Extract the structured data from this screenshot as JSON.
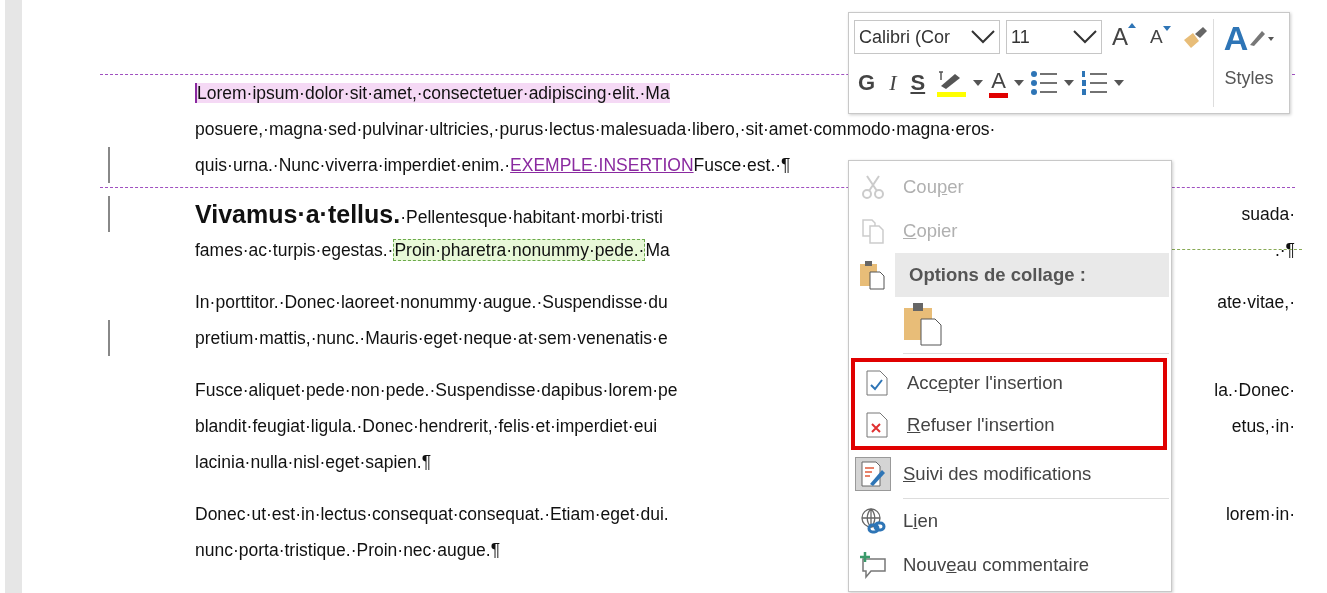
{
  "document": {
    "paragraphs": [
      {
        "kind": "tracked",
        "lines": [
          {
            "changed": false,
            "segments": [
              {
                "kind": "comment-highlight",
                "text": "Lorem·ipsum·dolor·sit·amet,·consectetuer·adipiscing·elit.·Ma"
              }
            ]
          },
          {
            "changed": false,
            "segments": [
              {
                "kind": "plain",
                "text": "posuere,·magna·sed·pulvinar·ultricies,·purus·lectus·malesuada·libero,·sit·amet·commodo·magna·eros·"
              }
            ]
          },
          {
            "changed": true,
            "segments": [
              {
                "kind": "plain",
                "text": "quis·urna.·Nunc·viverra·imperdiet·enim.·"
              },
              {
                "kind": "insertion",
                "text": "EXEMPLE·INSERTION"
              },
              {
                "kind": "plain",
                "text": "Fusce·est.·¶"
              }
            ]
          }
        ]
      },
      {
        "kind": "normal",
        "lines": [
          {
            "changed": true,
            "segments": [
              {
                "kind": "heading",
                "text": "Vivamus·a·tellus."
              },
              {
                "kind": "plain",
                "text": "·Pellentesque·habitant·morbi·tristi"
              }
            ],
            "right": "suada·"
          },
          {
            "changed": false,
            "segments": [
              {
                "kind": "plain",
                "text": "fames·ac·turpis·egestas.·"
              },
              {
                "kind": "format-highlight",
                "text": "Proin·pharetra·nonummy·pede.·"
              },
              {
                "kind": "plain",
                "text": "Ma"
              }
            ],
            "right": ".·¶"
          }
        ]
      },
      {
        "kind": "normal",
        "lines": [
          {
            "changed": false,
            "segments": [
              {
                "kind": "plain",
                "text": "In·porttitor.·Donec·laoreet·nonummy·augue.·Suspendisse·du"
              }
            ],
            "right": "ate·vitae,·"
          },
          {
            "changed": true,
            "segments": [
              {
                "kind": "plain",
                "text": "pretium·mattis,·nunc.·Mauris·eget·neque·at·sem·venenatis·e"
              }
            ]
          }
        ]
      },
      {
        "kind": "normal",
        "lines": [
          {
            "changed": false,
            "segments": [
              {
                "kind": "plain",
                "text": "Fusce·aliquet·pede·non·pede.·Suspendisse·dapibus·lorem·pe"
              }
            ],
            "right": "la.·Donec·"
          },
          {
            "changed": false,
            "segments": [
              {
                "kind": "plain",
                "text": "blandit·feugiat·ligula.·Donec·hendrerit,·felis·et·imperdiet·eui"
              }
            ],
            "right": "etus,·in·"
          },
          {
            "changed": false,
            "segments": [
              {
                "kind": "plain",
                "text": "lacinia·nulla·nisl·eget·sapien.¶"
              }
            ]
          }
        ]
      },
      {
        "kind": "normal",
        "lines": [
          {
            "changed": false,
            "segments": [
              {
                "kind": "plain",
                "text": "Donec·ut·est·in·lectus·consequat·consequat.·Etiam·eget·dui."
              }
            ],
            "right": "lorem·in·"
          },
          {
            "changed": false,
            "segments": [
              {
                "kind": "plain",
                "text": "nunc·porta·tristique.·Proin·nec·augue.¶"
              }
            ]
          }
        ]
      }
    ]
  },
  "mini_toolbar": {
    "font": "Calibri (Cor",
    "size": "11",
    "grow_label": "A",
    "shrink_label": "A",
    "styles_letter": "A",
    "bold": "G",
    "italic": "I",
    "strike": "S",
    "font_color_label": "A",
    "styles_label": "Styles"
  },
  "context_menu": {
    "items": [
      {
        "kind": "action",
        "pre": "Cou",
        "key": "p",
        "post": "er",
        "disabled": true,
        "checked": false,
        "framed": false
      },
      {
        "kind": "action",
        "key": "C",
        "post": "opier",
        "disabled": true,
        "checked": false,
        "framed": false
      },
      {
        "kind": "header",
        "pre": "Options de collage :",
        "framed": false
      },
      {
        "kind": "paste-options",
        "framed": false
      },
      {
        "kind": "action",
        "pre": "Acc",
        "key": "e",
        "post": "pter l'insertion",
        "disabled": false,
        "checked": false,
        "framed": true
      },
      {
        "kind": "action",
        "key": "R",
        "post": "efuser l'insertion",
        "disabled": false,
        "checked": false,
        "framed": true
      },
      {
        "kind": "action",
        "key": "S",
        "post": "uivi des modifications",
        "disabled": false,
        "checked": true,
        "framed": false
      },
      {
        "kind": "action",
        "pre": "L",
        "key": "i",
        "post": "en",
        "disabled": false,
        "checked": false,
        "framed": false
      },
      {
        "kind": "action",
        "pre": "Nouv",
        "key": "e",
        "post": "au commentaire",
        "disabled": false,
        "checked": false,
        "framed": false
      }
    ]
  }
}
